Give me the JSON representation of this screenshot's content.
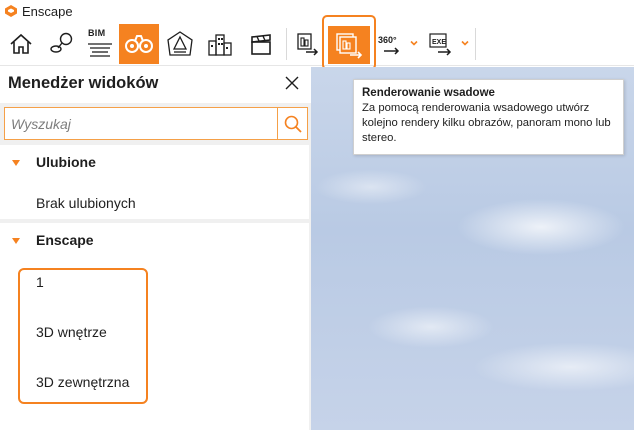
{
  "app": {
    "title": "Enscape",
    "brand_color": "#f58220"
  },
  "toolbar": {
    "buttons": [
      {
        "name": "home-icon",
        "tooltip": ""
      },
      {
        "name": "location-icon",
        "tooltip": ""
      },
      {
        "name": "bim-icon",
        "label": "BIM"
      },
      {
        "name": "binoculars-icon",
        "active": true
      },
      {
        "name": "atmosphere-icon"
      },
      {
        "name": "buildings-icon"
      },
      {
        "name": "clapperboard-icon"
      },
      {
        "name": "render-image-icon"
      },
      {
        "name": "batch-render-icon",
        "highlighted": true
      },
      {
        "name": "panorama-360-icon",
        "label": "360°"
      },
      {
        "name": "exe-export-icon",
        "label": "EXE"
      }
    ],
    "bim_label": "BIM",
    "pano_label": "360°",
    "exe_label": "EXE"
  },
  "tooltip": {
    "title": "Renderowanie wsadowe",
    "text": "Za pomocą renderowania wsadowego utwórz kolejno rendery kilku obrazów, panoram mono lub stereo."
  },
  "panel": {
    "title": "Menedżer widoków",
    "search": {
      "placeholder": "Wyszukaj",
      "value": ""
    },
    "sections": [
      {
        "title": "Ulubione",
        "items": [
          "Brak ulubionych"
        ]
      },
      {
        "title": "Enscape",
        "items": [
          "1",
          "3D wnętrze",
          "3D zewnętrzna"
        ]
      }
    ]
  }
}
